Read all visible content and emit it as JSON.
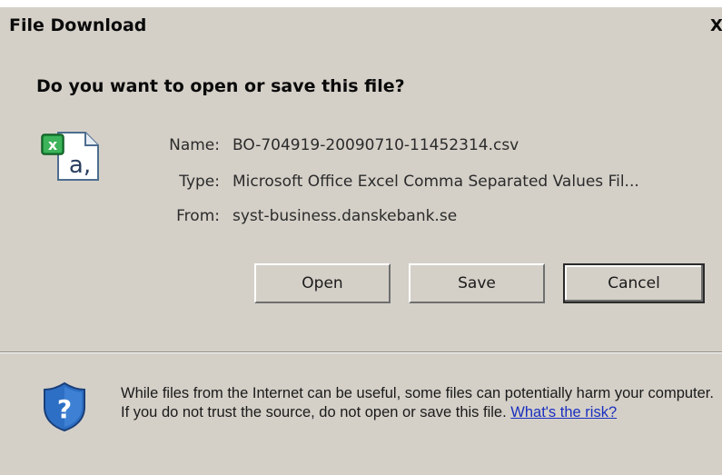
{
  "window": {
    "title": "File Download",
    "close_glyph": "X"
  },
  "dialog": {
    "heading": "Do you want to open or save this file?",
    "file": {
      "icon": "excel-csv-file-icon",
      "name_label": "Name:",
      "name_value": "BO-704919-20090710-11452314.csv",
      "type_label": "Type:",
      "type_value": "Microsoft Office Excel Comma Separated Values Fil...",
      "from_label": "From:",
      "from_value": "syst-business.danskebank.se"
    },
    "buttons": {
      "open": "Open",
      "save": "Save",
      "cancel": "Cancel"
    }
  },
  "warning": {
    "icon": "security-shield-question-icon",
    "text": "While files from the Internet can be useful, some files can potentially harm your computer. If you do not trust the source, do not open or save this file.",
    "link": "What's the risk?"
  },
  "colors": {
    "dialog_bg": "#d4d0c8",
    "link": "#1a2fbf",
    "shield_blue": "#2d6fc4",
    "excel_green": "#1f8b3a"
  }
}
